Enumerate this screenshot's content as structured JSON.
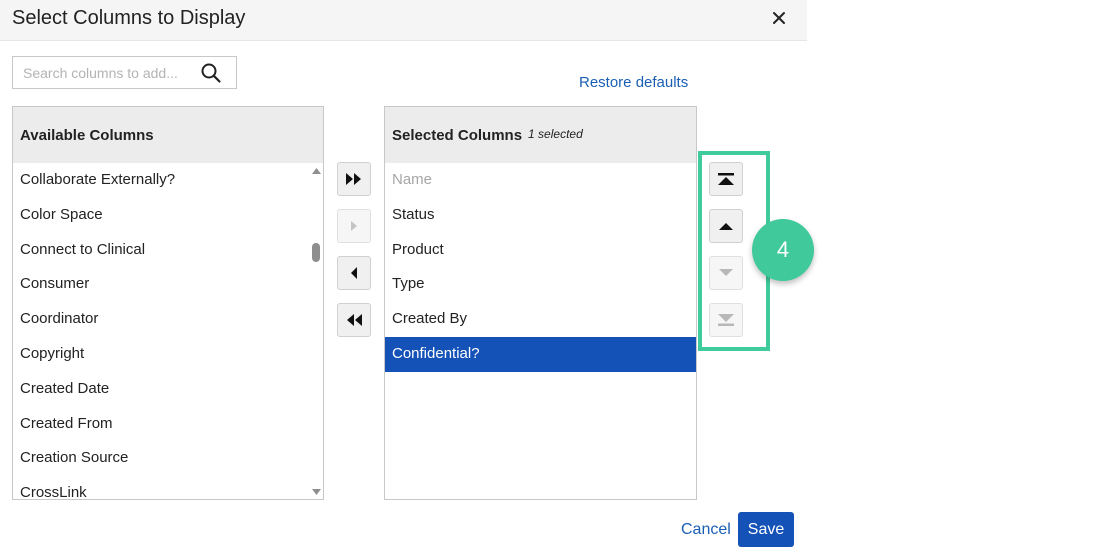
{
  "dialog": {
    "title": "Select Columns to Display"
  },
  "search": {
    "placeholder": "Search columns to add..."
  },
  "restore_label": "Restore defaults",
  "available": {
    "header": "Available Columns",
    "items": [
      "Collaborate Externally?",
      "Color Space",
      "Connect to Clinical",
      "Consumer",
      "Coordinator",
      "Copyright",
      "Created Date",
      "Created From",
      "Creation Source",
      "CrossLink"
    ]
  },
  "selected": {
    "header": "Selected Columns",
    "count_label": "1 selected",
    "items": [
      "Name",
      "Status",
      "Product",
      "Type",
      "Created By",
      "Confidential?"
    ]
  },
  "callout": {
    "number": "4"
  },
  "footer": {
    "cancel_label": "Cancel",
    "save_label": "Save"
  },
  "colors": {
    "accent": "#1452b8",
    "highlight": "#3fcb9c",
    "link": "#1a5fb4"
  }
}
